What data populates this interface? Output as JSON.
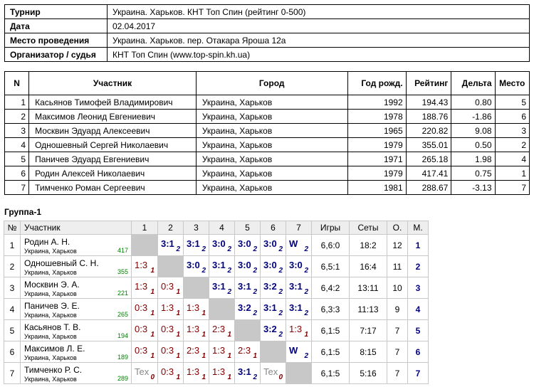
{
  "info": [
    {
      "key": "Турнир",
      "value": "Украина. Харьков. КНТ Топ Спин (рейтинг 0-500)"
    },
    {
      "key": "Дата",
      "value": "02.04.2017"
    },
    {
      "key": "Место проведения",
      "value": "Украина. Харьков. пер. Отакара Яроша 12а"
    },
    {
      "key": "Организатор / судья",
      "value": "КНТ Топ Спин (www.top-spin.kh.ua)"
    }
  ],
  "participants": {
    "headers": [
      "N",
      "Участник",
      "Город",
      "Год рожд.",
      "Рейтинг",
      "Дельта",
      "Место"
    ],
    "rows": [
      [
        "1",
        "Касьянов Тимофей Владимирович",
        "Украина, Харьков",
        "1992",
        "194.43",
        "0.80",
        "5"
      ],
      [
        "2",
        "Максимов Леонид Евгениевич",
        "Украина, Харьков",
        "1978",
        "188.76",
        "-1.86",
        "6"
      ],
      [
        "3",
        "Москвин Эдуард Алексеевич",
        "Украина, Харьков",
        "1965",
        "220.82",
        "9.08",
        "3"
      ],
      [
        "4",
        "Одношевный Сергей Николаевич",
        "Украина, Харьков",
        "1979",
        "355.01",
        "0.50",
        "2"
      ],
      [
        "5",
        "Паничев Эдуард Евгениевич",
        "Украина, Харьков",
        "1971",
        "265.18",
        "1.98",
        "4"
      ],
      [
        "6",
        "Родин Алексей Николаевич",
        "Украина, Харьков",
        "1979",
        "417.41",
        "0.75",
        "1"
      ],
      [
        "7",
        "Тимченко Роман Сергеевич",
        "Украина, Харьков",
        "1981",
        "288.67",
        "-3.13",
        "7"
      ]
    ]
  },
  "group": {
    "title": "Группа-1",
    "headers": [
      "№",
      "Участник",
      "1",
      "2",
      "3",
      "4",
      "5",
      "6",
      "7",
      "Игры",
      "Сеты",
      "О.",
      "М."
    ],
    "rows": [
      {
        "n": "1",
        "name": "Родин А. Н.",
        "city": "Украина, Харьков",
        "rating": "417",
        "results": [
          null,
          {
            "s": "3:1",
            "p": "2",
            "t": "win"
          },
          {
            "s": "3:1",
            "p": "2",
            "t": "win"
          },
          {
            "s": "3:0",
            "p": "2",
            "t": "win"
          },
          {
            "s": "3:0",
            "p": "2",
            "t": "win"
          },
          {
            "s": "3:0",
            "p": "2",
            "t": "win"
          },
          {
            "s": "W",
            "p": "2",
            "t": "win"
          }
        ],
        "games": "6,6:0",
        "sets": "18:2",
        "points": "12",
        "place": "1"
      },
      {
        "n": "2",
        "name": "Одношевный С. Н.",
        "city": "Украина, Харьков",
        "rating": "355",
        "results": [
          {
            "s": "1:3",
            "p": "1",
            "t": "loss"
          },
          null,
          {
            "s": "3:0",
            "p": "2",
            "t": "win"
          },
          {
            "s": "3:1",
            "p": "2",
            "t": "win"
          },
          {
            "s": "3:0",
            "p": "2",
            "t": "win"
          },
          {
            "s": "3:0",
            "p": "2",
            "t": "win"
          },
          {
            "s": "3:0",
            "p": "2",
            "t": "win"
          }
        ],
        "games": "6,5:1",
        "sets": "16:4",
        "points": "11",
        "place": "2"
      },
      {
        "n": "3",
        "name": "Москвин Э. А.",
        "city": "Украина, Харьков",
        "rating": "221",
        "results": [
          {
            "s": "1:3",
            "p": "1",
            "t": "loss"
          },
          {
            "s": "0:3",
            "p": "1",
            "t": "loss"
          },
          null,
          {
            "s": "3:1",
            "p": "2",
            "t": "win"
          },
          {
            "s": "3:1",
            "p": "2",
            "t": "win"
          },
          {
            "s": "3:2",
            "p": "2",
            "t": "win"
          },
          {
            "s": "3:1",
            "p": "2",
            "t": "win"
          }
        ],
        "games": "6,4:2",
        "sets": "13:11",
        "points": "10",
        "place": "3"
      },
      {
        "n": "4",
        "name": "Паничев Э. Е.",
        "city": "Украина, Харьков",
        "rating": "265",
        "results": [
          {
            "s": "0:3",
            "p": "1",
            "t": "loss"
          },
          {
            "s": "1:3",
            "p": "1",
            "t": "loss"
          },
          {
            "s": "1:3",
            "p": "1",
            "t": "loss"
          },
          null,
          {
            "s": "3:2",
            "p": "2",
            "t": "win"
          },
          {
            "s": "3:1",
            "p": "2",
            "t": "win"
          },
          {
            "s": "3:1",
            "p": "2",
            "t": "win"
          }
        ],
        "games": "6,3:3",
        "sets": "11:13",
        "points": "9",
        "place": "4"
      },
      {
        "n": "5",
        "name": "Касьянов Т. В.",
        "city": "Украина, Харьков",
        "rating": "194",
        "results": [
          {
            "s": "0:3",
            "p": "1",
            "t": "loss"
          },
          {
            "s": "0:3",
            "p": "1",
            "t": "loss"
          },
          {
            "s": "1:3",
            "p": "1",
            "t": "loss"
          },
          {
            "s": "2:3",
            "p": "1",
            "t": "loss"
          },
          null,
          {
            "s": "3:2",
            "p": "2",
            "t": "win"
          },
          {
            "s": "1:3",
            "p": "1",
            "t": "loss"
          }
        ],
        "games": "6,1:5",
        "sets": "7:17",
        "points": "7",
        "place": "5"
      },
      {
        "n": "6",
        "name": "Максимов Л. Е.",
        "city": "Украина, Харьков",
        "rating": "189",
        "results": [
          {
            "s": "0:3",
            "p": "1",
            "t": "loss"
          },
          {
            "s": "0:3",
            "p": "1",
            "t": "loss"
          },
          {
            "s": "2:3",
            "p": "1",
            "t": "loss"
          },
          {
            "s": "1:3",
            "p": "1",
            "t": "loss"
          },
          {
            "s": "2:3",
            "p": "1",
            "t": "loss"
          },
          null,
          {
            "s": "W",
            "p": "2",
            "t": "win"
          }
        ],
        "games": "6,1:5",
        "sets": "8:15",
        "points": "7",
        "place": "6"
      },
      {
        "n": "7",
        "name": "Тимченко Р. С.",
        "city": "Украина, Харьков",
        "rating": "289",
        "results": [
          {
            "s": "Tex",
            "p": "0",
            "t": "tech"
          },
          {
            "s": "0:3",
            "p": "1",
            "t": "loss"
          },
          {
            "s": "1:3",
            "p": "1",
            "t": "loss"
          },
          {
            "s": "1:3",
            "p": "1",
            "t": "loss"
          },
          {
            "s": "3:1",
            "p": "2",
            "t": "win"
          },
          {
            "s": "Tex",
            "p": "0",
            "t": "tech"
          },
          null
        ],
        "games": "6,1:5",
        "sets": "5:16",
        "points": "7",
        "place": "7"
      }
    ]
  }
}
